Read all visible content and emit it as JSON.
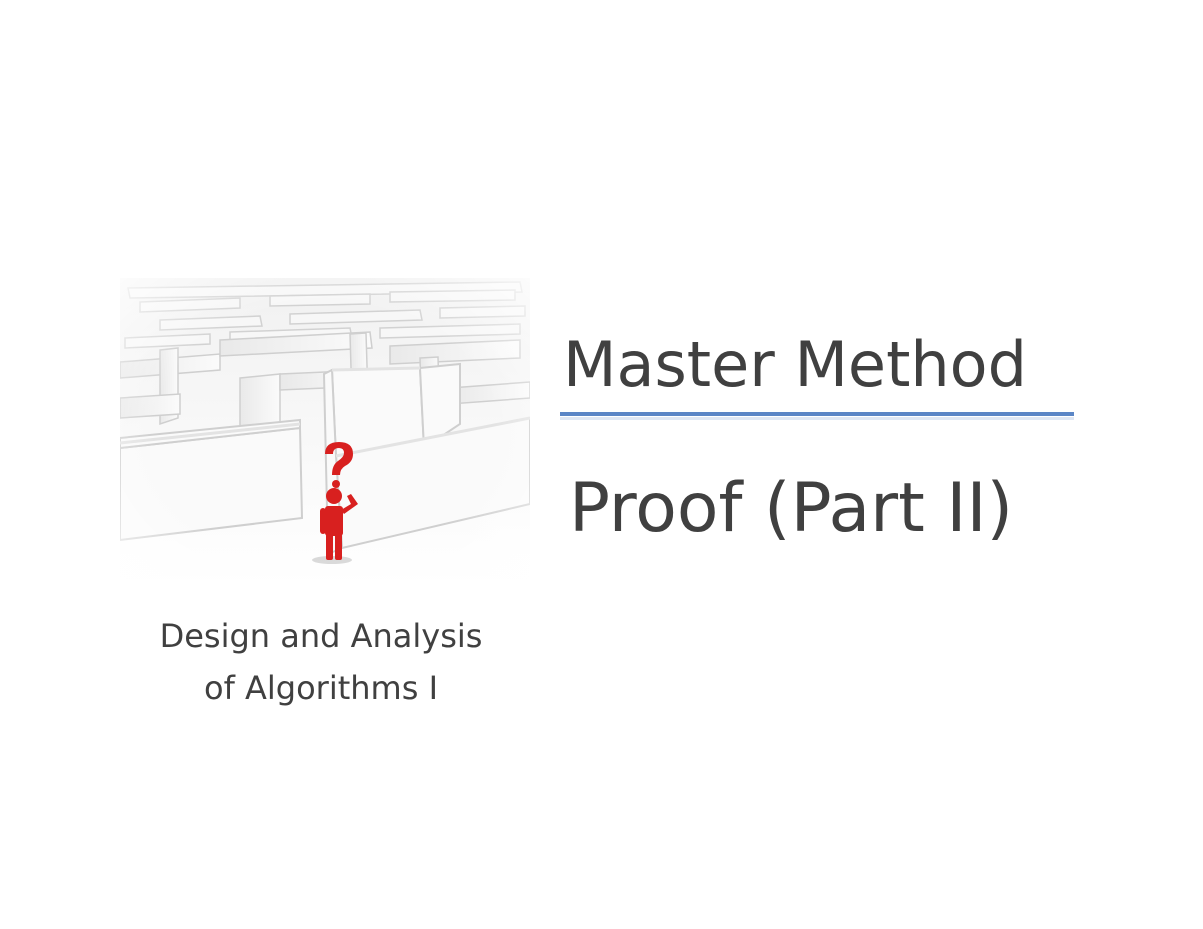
{
  "slide": {
    "title": "Master Method",
    "part_title": "Proof (Part II)",
    "course_line_1": "Design and Analysis",
    "course_line_2": "of Algorithms I"
  },
  "colors": {
    "text": "#404040",
    "rule": "#5b86c6",
    "figure": "#d8201f"
  },
  "image": {
    "icon": "maze-question-figure-icon"
  }
}
